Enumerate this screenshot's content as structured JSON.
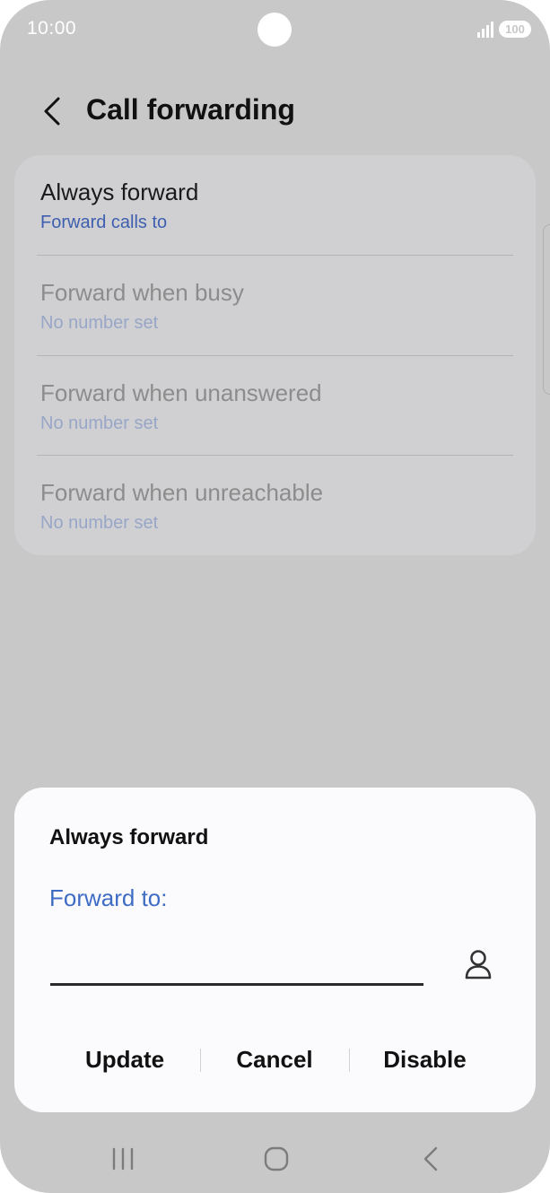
{
  "status_bar": {
    "time": "10:00",
    "battery": "100",
    "signal_icon": "signal-icon",
    "battery_icon": "battery-icon"
  },
  "header": {
    "title": "Call forwarding",
    "back_icon": "chevron-left-icon"
  },
  "forwarding_options": [
    {
      "title": "Always forward",
      "subtitle": "Forward calls to",
      "enabled": true
    },
    {
      "title": "Forward when busy",
      "subtitle": "No number set",
      "enabled": false
    },
    {
      "title": "Forward when unanswered",
      "subtitle": "No number set",
      "enabled": false
    },
    {
      "title": "Forward when unreachable",
      "subtitle": "No number set",
      "enabled": false
    }
  ],
  "dialog": {
    "title": "Always forward",
    "label": "Forward to:",
    "input_value": "",
    "contact_icon": "person-icon",
    "actions": {
      "update": "Update",
      "cancel": "Cancel",
      "disable": "Disable"
    }
  },
  "nav_bar": {
    "recents_icon": "recents-icon",
    "home_icon": "home-icon",
    "back_icon": "back-icon"
  },
  "colors": {
    "background_dim": "#c8c8c8",
    "card": "#d0d0d2",
    "dialog": "#fbfbfd",
    "accent_blue": "#3e6bc4",
    "text_primary": "#111111",
    "text_disabled": "#8c8c8c"
  }
}
